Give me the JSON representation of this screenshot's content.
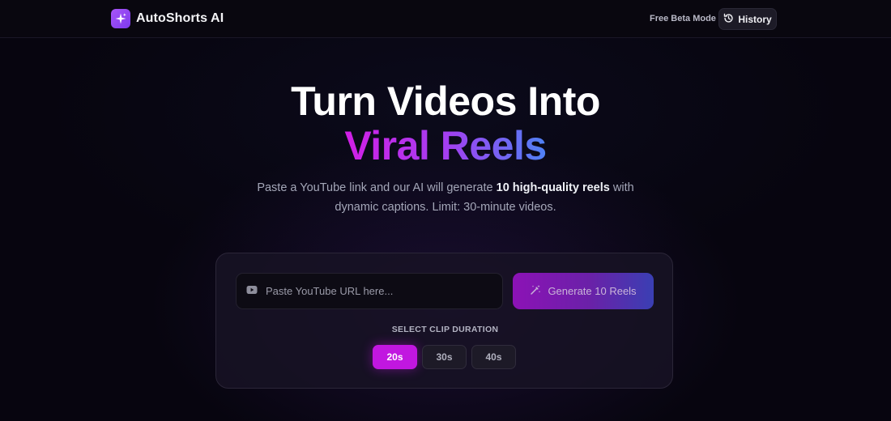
{
  "header": {
    "app_name": "AutoShorts AI",
    "beta_label": "Free Beta Mode",
    "history_label": "History"
  },
  "hero": {
    "title_line1": "Turn Videos Into",
    "title_line2": "Viral Reels",
    "subtitle_pre": "Paste a YouTube link and our AI will generate ",
    "subtitle_bold": "10 high-quality reels",
    "subtitle_post": " with",
    "subtitle_line2": "dynamic captions. Limit: 30-minute videos."
  },
  "form": {
    "url_placeholder": "Paste YouTube URL here...",
    "url_value": "",
    "generate_label": "Generate 10 Reels",
    "duration_label": "SELECT CLIP DURATION",
    "durations": [
      "20s",
      "30s",
      "40s"
    ],
    "selected_duration": "20s"
  },
  "colors": {
    "accent": "#c117e0",
    "background": "#07050f",
    "gradient_start": "#d21fe6",
    "gradient_end": "#4e82f5"
  },
  "icons": {
    "brand": "sparkles-icon",
    "history": "history-icon",
    "url": "youtube-icon",
    "generate": "magic-wand-icon"
  }
}
